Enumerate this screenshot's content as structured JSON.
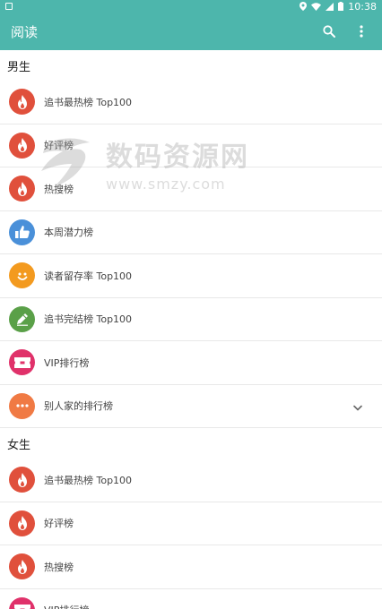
{
  "status_bar": {
    "time": "10:38"
  },
  "app_bar": {
    "title": "阅读"
  },
  "sections": [
    {
      "title": "男生",
      "items": [
        {
          "label": "追书最热榜 Top100",
          "icon": "flame-icon",
          "color": "#e0503c"
        },
        {
          "label": "好评榜",
          "icon": "flame-icon",
          "color": "#e0503c"
        },
        {
          "label": "热搜榜",
          "icon": "flame-icon",
          "color": "#e0503c"
        },
        {
          "label": "本周潜力榜",
          "icon": "thumbs-up-icon",
          "color": "#4a90d9"
        },
        {
          "label": "读者留存率 Top100",
          "icon": "smiley-icon",
          "color": "#f39a1f"
        },
        {
          "label": "追书完结榜 Top100",
          "icon": "pen-icon",
          "color": "#5aa048"
        },
        {
          "label": "VIP排行榜",
          "icon": "vip-ticket-icon",
          "color": "#e0316a"
        },
        {
          "label": "别人家的排行榜",
          "icon": "more-dots-icon",
          "color": "#f07a44"
        }
      ]
    },
    {
      "title": "女生",
      "items": [
        {
          "label": "追书最热榜 Top100",
          "icon": "flame-icon",
          "color": "#e0503c"
        },
        {
          "label": "好评榜",
          "icon": "flame-icon",
          "color": "#e0503c"
        },
        {
          "label": "热搜榜",
          "icon": "flame-icon",
          "color": "#e0503c"
        },
        {
          "label": "VIP排行榜",
          "icon": "vip-ticket-icon",
          "color": "#e0316a"
        }
      ]
    }
  ],
  "watermark": {
    "main": "数码资源网",
    "sub": "www.smzy.com"
  },
  "colors": {
    "primary": "#4db6ac"
  }
}
